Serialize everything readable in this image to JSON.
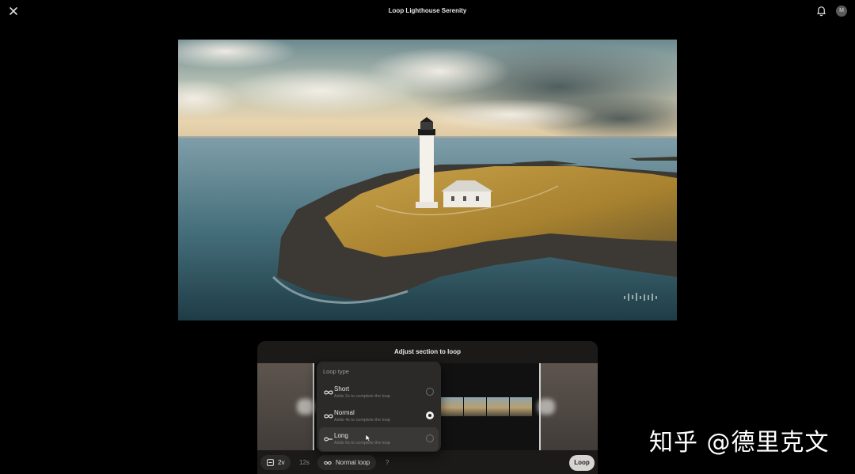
{
  "header": {
    "title": "Loop Lighthouse Serenity",
    "avatar_initial": "M"
  },
  "panel": {
    "title": "Adjust section to loop",
    "duration_chip": "2v",
    "length_label": "12s",
    "loop_type_chip": "Normal loop",
    "help_label": "?",
    "loop_button": "Loop"
  },
  "dropdown": {
    "header": "Loop type",
    "options": [
      {
        "label": "Short",
        "desc": "Adds 2s to complete the loop",
        "selected": false
      },
      {
        "label": "Normal",
        "desc": "Adds 4s to complete the loop",
        "selected": true
      },
      {
        "label": "Long",
        "desc": "Adds 6s to complete the loop",
        "selected": false
      }
    ]
  },
  "watermark": "知乎 @德里克文",
  "colors": {
    "background": "#000000",
    "panel": "#1b1a19",
    "dropdown": "#2b2a28",
    "accent_button": "#d7d5d1"
  },
  "icons": [
    "close-icon",
    "bell-icon",
    "loop-icon",
    "calendar-icon",
    "waveform-icon",
    "cursor-icon"
  ]
}
